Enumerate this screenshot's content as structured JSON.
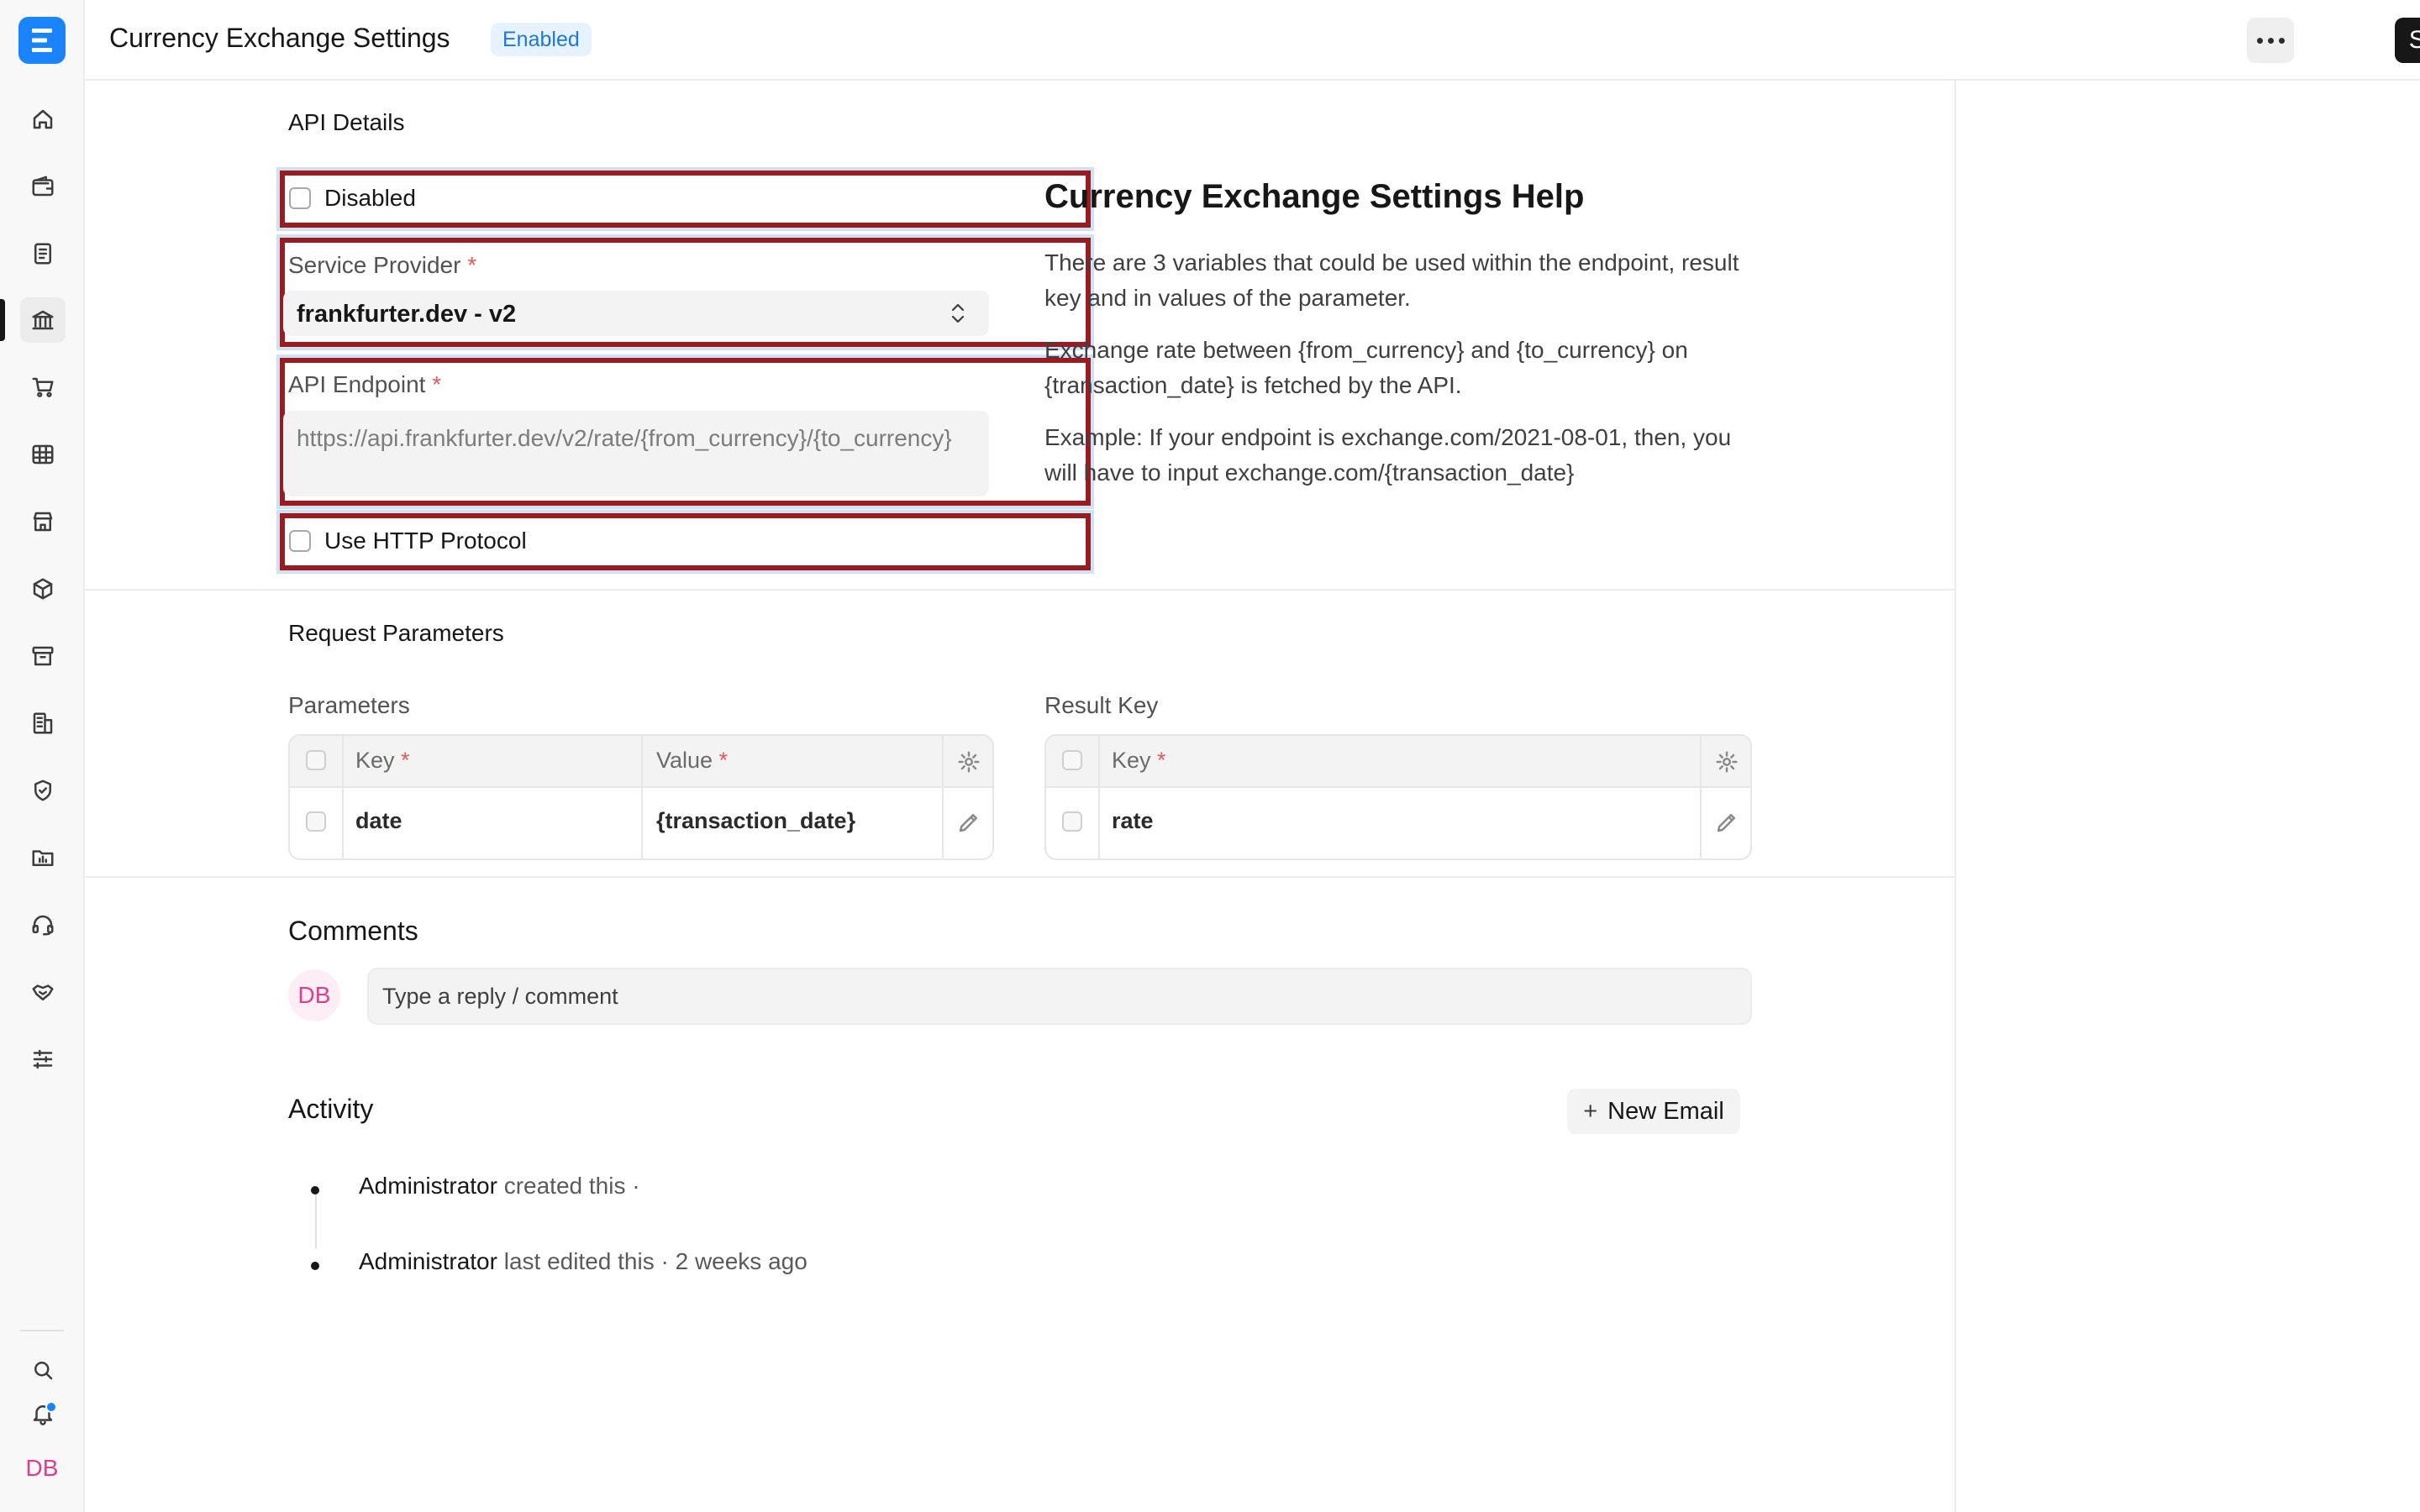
{
  "header": {
    "title": "Currency Exchange Settings",
    "status": "Enabled",
    "save_label": "Save"
  },
  "api_details": {
    "section_title": "API Details",
    "disabled_label": "Disabled",
    "disabled_checked": false,
    "service_provider_label": "Service Provider",
    "service_provider_value": "frankfurter.dev - v2",
    "api_endpoint_label": "API Endpoint",
    "api_endpoint_value": "https://api.frankfurter.dev/v2/rate/{from_currency}/{to_currency}",
    "use_http_label": "Use HTTP Protocol",
    "use_http_checked": false,
    "required_mark": "*"
  },
  "help": {
    "title": "Currency Exchange Settings Help",
    "para1": "There are 3 variables that could be used within the endpoint, result key and in values of the parameter.",
    "para2": "Exchange rate between {from_currency} and {to_currency} on {transaction_date} is fetched by the API.",
    "para3": "Example: If your endpoint is exchange.com/2021-08-01, then, you will have to input exchange.com/{transaction_date}"
  },
  "request_parameters": {
    "section_title": "Request Parameters",
    "parameters": {
      "label": "Parameters",
      "columns": [
        "Key",
        "Value"
      ],
      "rows": [
        {
          "key": "date",
          "value": "{transaction_date}"
        }
      ]
    },
    "result_key": {
      "label": "Result Key",
      "columns": [
        "Key"
      ],
      "rows": [
        {
          "key": "rate"
        }
      ]
    }
  },
  "comments": {
    "title": "Comments",
    "avatar_initials": "DB",
    "placeholder": "Type a reply / comment"
  },
  "activity": {
    "title": "Activity",
    "new_email_label": "New Email",
    "new_email_icon": "+",
    "items": [
      {
        "actor": "Administrator",
        "text": " created this ·"
      },
      {
        "actor": "Administrator",
        "text": " last edited this · 2 weeks ago"
      }
    ]
  },
  "sidebar": {
    "user_initials": "DB",
    "icons": [
      "home-icon",
      "wallet-icon",
      "document-icon",
      "bank-icon",
      "cart-icon",
      "table-icon",
      "store-icon",
      "package-icon",
      "archive-icon",
      "building-icon",
      "shield-icon",
      "folder-chart-icon",
      "headset-icon",
      "handshake-icon",
      "sliders-icon",
      "search-icon",
      "bell-icon"
    ],
    "active_item": "bank-icon"
  },
  "colors": {
    "brand": "#1a84ff",
    "highlight_border": "#9a1c20",
    "badge_bg": "#e6f3ff",
    "badge_text": "#1e77d8",
    "required": "#e35a5a",
    "avatar": "#e03d8f"
  }
}
